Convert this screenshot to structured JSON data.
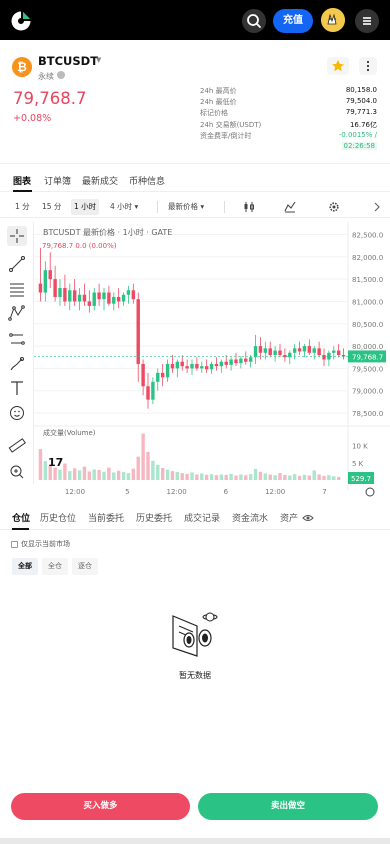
{
  "topbar": {
    "deposit_label": "充值",
    "icons": [
      "logo-icon",
      "search-icon",
      "avatar-icon",
      "menu-icon"
    ]
  },
  "ticker": {
    "symbol": "BTCUSDT",
    "contract_type": "永续",
    "last_price": "79,768.7",
    "change_pct": "+0.08%",
    "stats": [
      {
        "label": "24h 最高价",
        "value": "80,158.0"
      },
      {
        "label": "24h 最低价",
        "value": "79,504.0"
      },
      {
        "label": "标记价格",
        "value": "79,771.3"
      },
      {
        "label": "24h 交易额(USDT)",
        "value": "16.76亿"
      },
      {
        "label": "资金费率/倒计时",
        "value": "-0.0015% /"
      },
      {
        "label": "",
        "value": "02:26:58"
      }
    ]
  },
  "chart_tabs": [
    "图表",
    "订单簿",
    "最新成交",
    "币种信息"
  ],
  "intervals": {
    "items": [
      "1 分",
      "15 分",
      "1 小时",
      "4 小时 ▾"
    ],
    "price_type": "最新价格 ▾"
  },
  "chart": {
    "legend": "BTCUSDT 最新价格 · 1小时 · GATE",
    "ohlc": "79,768.7  0.0  (0.00%)",
    "volume_label": "成交量(Volume)",
    "current_price_tag": "79,768.7",
    "current_volume_tag": "529.7"
  },
  "chart_data": {
    "type": "candlestick",
    "price_axis_ticks": [
      "82,500.0",
      "82,000.0",
      "81,500.0",
      "81,000.0",
      "80,500.0",
      "80,000.0",
      "79,500.0",
      "79,000.0",
      "78,500.0"
    ],
    "price_range": [
      78300,
      82600
    ],
    "volume_axis_ticks": [
      "10 K",
      "5 K"
    ],
    "volume_range": [
      0,
      14000
    ],
    "time_ticks": [
      "12:00",
      "5",
      "12:00",
      "6",
      "12:00",
      "7"
    ],
    "last_price": 79768.7,
    "last_volume": 529.7,
    "candles": [
      {
        "o": 81400,
        "h": 82200,
        "l": 81000,
        "c": 81200
      },
      {
        "o": 81200,
        "h": 81900,
        "l": 81000,
        "c": 81700
      },
      {
        "o": 81700,
        "h": 82100,
        "l": 81300,
        "c": 81500
      },
      {
        "o": 81500,
        "h": 81800,
        "l": 81000,
        "c": 81100
      },
      {
        "o": 81100,
        "h": 81500,
        "l": 80900,
        "c": 81300
      },
      {
        "o": 81300,
        "h": 81600,
        "l": 80900,
        "c": 81000
      },
      {
        "o": 81000,
        "h": 81400,
        "l": 80800,
        "c": 81250
      },
      {
        "o": 81250,
        "h": 81500,
        "l": 80900,
        "c": 81000
      },
      {
        "o": 81000,
        "h": 81300,
        "l": 80800,
        "c": 81150
      },
      {
        "o": 81150,
        "h": 81400,
        "l": 80900,
        "c": 81000
      },
      {
        "o": 81000,
        "h": 81250,
        "l": 80750,
        "c": 80900
      },
      {
        "o": 80900,
        "h": 81300,
        "l": 80800,
        "c": 81200
      },
      {
        "o": 81200,
        "h": 81400,
        "l": 80900,
        "c": 81050
      },
      {
        "o": 81050,
        "h": 81300,
        "l": 80800,
        "c": 81200
      },
      {
        "o": 81200,
        "h": 81350,
        "l": 80900,
        "c": 80950
      },
      {
        "o": 80950,
        "h": 81200,
        "l": 80800,
        "c": 81100
      },
      {
        "o": 81100,
        "h": 81300,
        "l": 80850,
        "c": 81000
      },
      {
        "o": 81000,
        "h": 81200,
        "l": 80900,
        "c": 81150
      },
      {
        "o": 81150,
        "h": 81350,
        "l": 80950,
        "c": 81250
      },
      {
        "o": 81250,
        "h": 81400,
        "l": 80950,
        "c": 81050
      },
      {
        "o": 81050,
        "h": 81200,
        "l": 79200,
        "c": 79600
      },
      {
        "o": 79600,
        "h": 79700,
        "l": 78900,
        "c": 79100
      },
      {
        "o": 79100,
        "h": 79400,
        "l": 78600,
        "c": 78800
      },
      {
        "o": 78800,
        "h": 79300,
        "l": 78700,
        "c": 79200
      },
      {
        "o": 79200,
        "h": 79500,
        "l": 79000,
        "c": 79400
      },
      {
        "o": 79400,
        "h": 79600,
        "l": 79100,
        "c": 79300
      },
      {
        "o": 79300,
        "h": 79700,
        "l": 79200,
        "c": 79600
      },
      {
        "o": 79600,
        "h": 79800,
        "l": 79400,
        "c": 79500
      },
      {
        "o": 79500,
        "h": 79700,
        "l": 79300,
        "c": 79650
      },
      {
        "o": 79650,
        "h": 79800,
        "l": 79450,
        "c": 79550
      },
      {
        "o": 79550,
        "h": 79700,
        "l": 79400,
        "c": 79500
      },
      {
        "o": 79500,
        "h": 79700,
        "l": 79350,
        "c": 79600
      },
      {
        "o": 79600,
        "h": 79750,
        "l": 79450,
        "c": 79500
      },
      {
        "o": 79500,
        "h": 79650,
        "l": 79400,
        "c": 79550
      },
      {
        "o": 79550,
        "h": 79700,
        "l": 79400,
        "c": 79480
      },
      {
        "o": 79480,
        "h": 79650,
        "l": 79380,
        "c": 79600
      },
      {
        "o": 79600,
        "h": 79750,
        "l": 79450,
        "c": 79550
      },
      {
        "o": 79550,
        "h": 79700,
        "l": 79400,
        "c": 79650
      },
      {
        "o": 79650,
        "h": 79800,
        "l": 79500,
        "c": 79580
      },
      {
        "o": 79580,
        "h": 79750,
        "l": 79450,
        "c": 79700
      },
      {
        "o": 79700,
        "h": 79850,
        "l": 79550,
        "c": 79620
      },
      {
        "o": 79620,
        "h": 79780,
        "l": 79500,
        "c": 79720
      },
      {
        "o": 79720,
        "h": 79880,
        "l": 79580,
        "c": 79650
      },
      {
        "o": 79650,
        "h": 79800,
        "l": 79520,
        "c": 79750
      },
      {
        "o": 79750,
        "h": 80250,
        "l": 79600,
        "c": 80000
      },
      {
        "o": 80000,
        "h": 80200,
        "l": 79700,
        "c": 79850
      },
      {
        "o": 79850,
        "h": 80100,
        "l": 79700,
        "c": 79950
      },
      {
        "o": 79950,
        "h": 80100,
        "l": 79750,
        "c": 79800
      },
      {
        "o": 79800,
        "h": 80000,
        "l": 79650,
        "c": 79900
      },
      {
        "o": 79900,
        "h": 80050,
        "l": 79750,
        "c": 79800
      },
      {
        "o": 79800,
        "h": 79950,
        "l": 79650,
        "c": 79750
      },
      {
        "o": 79750,
        "h": 79900,
        "l": 79600,
        "c": 79850
      },
      {
        "o": 79850,
        "h": 80050,
        "l": 79700,
        "c": 79950
      },
      {
        "o": 79950,
        "h": 80100,
        "l": 79800,
        "c": 79880
      },
      {
        "o": 79880,
        "h": 80050,
        "l": 79750,
        "c": 80000
      },
      {
        "o": 80000,
        "h": 80150,
        "l": 79800,
        "c": 79850
      },
      {
        "o": 79850,
        "h": 80000,
        "l": 79700,
        "c": 79950
      },
      {
        "o": 79950,
        "h": 80100,
        "l": 79750,
        "c": 79800
      },
      {
        "o": 79800,
        "h": 79950,
        "l": 79550,
        "c": 79700
      },
      {
        "o": 79700,
        "h": 79900,
        "l": 79550,
        "c": 79850
      },
      {
        "o": 79850,
        "h": 80000,
        "l": 79700,
        "c": 79900
      },
      {
        "o": 79900,
        "h": 80050,
        "l": 79750,
        "c": 79800
      },
      {
        "o": 79800,
        "h": 79950,
        "l": 79700,
        "c": 79768.7
      }
    ],
    "volumes": [
      9000,
      5500,
      4200,
      3600,
      3000,
      4800,
      2600,
      3400,
      2800,
      3900,
      2500,
      3100,
      2900,
      2400,
      3600,
      2200,
      2700,
      2300,
      2000,
      3300,
      6800,
      13500,
      8200,
      5600,
      4400,
      3500,
      3000,
      2600,
      2300,
      2000,
      1800,
      2200,
      1600,
      1900,
      1500,
      1700,
      1400,
      1600,
      1500,
      1800,
      1300,
      1600,
      1400,
      1700,
      3200,
      2400,
      1900,
      1600,
      1400,
      2000,
      1500,
      1300,
      1700,
      1200,
      1500,
      1300,
      2800,
      1600,
      1200,
      1400,
      1100,
      900
    ]
  },
  "position_tabs": [
    "仓位",
    "历史仓位",
    "当前委托",
    "历史委托",
    "成交记录",
    "资金流水",
    "资产"
  ],
  "positions": {
    "current_only_label": "仅显示当前市场",
    "filters": [
      "全部",
      "全仓",
      "逐仓"
    ],
    "empty_text": "暂无数据"
  },
  "actions": {
    "buy_label": "买入做多",
    "sell_label": "卖出做空"
  },
  "colors": {
    "up": "#2bc385",
    "down": "#ee4a63",
    "accent": "#1565f5"
  }
}
